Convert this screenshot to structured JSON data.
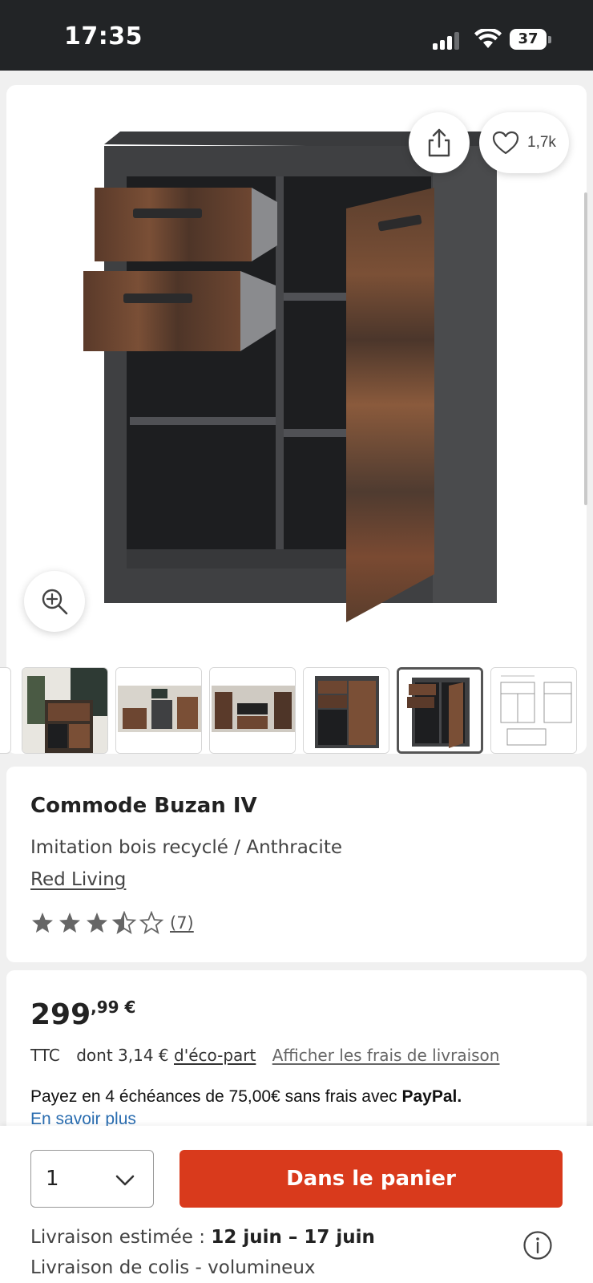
{
  "status_bar": {
    "time": "17:35",
    "battery": "37"
  },
  "gallery": {
    "favorite_count": "1,7k",
    "selected_index": 4,
    "thumbnail_count": 6
  },
  "product": {
    "title": "Commode Buzan IV",
    "variant": "Imitation bois recyclé / Anthracite",
    "brand": "Red Living",
    "rating": 3.5,
    "rating_max": 5,
    "review_count": "(7)"
  },
  "price": {
    "integer": "299",
    "decimals": ",99 €",
    "ttc": "TTC",
    "eco_prefix": "dont 3,14 €",
    "eco_link": "d'éco-part",
    "shipping_link": "Afficher les frais de livraison",
    "paypal_text": "Payez en 4 échéances de 75,00€ sans frais avec",
    "paypal_brand": "PayPal.",
    "more_link": "En savoir plus"
  },
  "purchase": {
    "quantity": "1",
    "cart_button": "Dans le panier",
    "delivery_label": "Livraison estimée :",
    "delivery_dates": "12 juin – 17 juin",
    "delivery_type": "Livraison de colis - volumineux"
  },
  "colors": {
    "accent": "#d93a1c",
    "link": "#2a6db0",
    "status_bar": "#222426"
  }
}
